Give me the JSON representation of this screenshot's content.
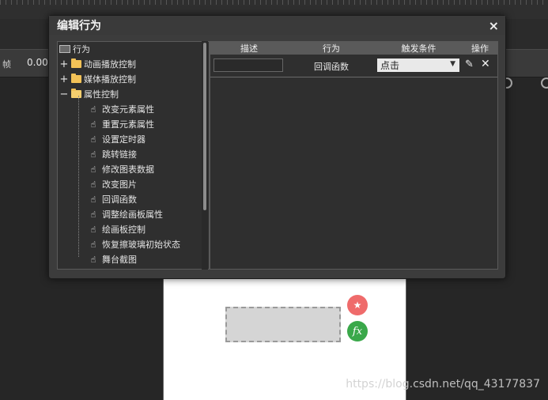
{
  "background": {
    "frame_label": "帧",
    "frame_value": "0.00",
    "watermark": "https://blog.csdn.net/qq_43177837",
    "fab_star_icon": "star-plus-icon",
    "fab_fx_label": "fx"
  },
  "dialog": {
    "title": "编辑行为",
    "close_symbol": "×",
    "tree": {
      "root": "行为",
      "groups": [
        {
          "label": "动画播放控制",
          "toggle": "+"
        },
        {
          "label": "媒体播放控制",
          "toggle": "+"
        },
        {
          "label": "属性控制",
          "toggle": "−"
        }
      ],
      "children": [
        "改变元素属性",
        "重置元素属性",
        "设置定时器",
        "跳转链接",
        "修改图表数据",
        "改变图片",
        "回调函数",
        "调整绘画板属性",
        "绘画板控制",
        "恢复擦玻璃初始状态",
        "舞台截图"
      ]
    },
    "table": {
      "headers": [
        "描述",
        "行为",
        "触发条件",
        "操作"
      ],
      "row": {
        "description": "",
        "action": "回调函数",
        "trigger": "点击"
      }
    }
  }
}
